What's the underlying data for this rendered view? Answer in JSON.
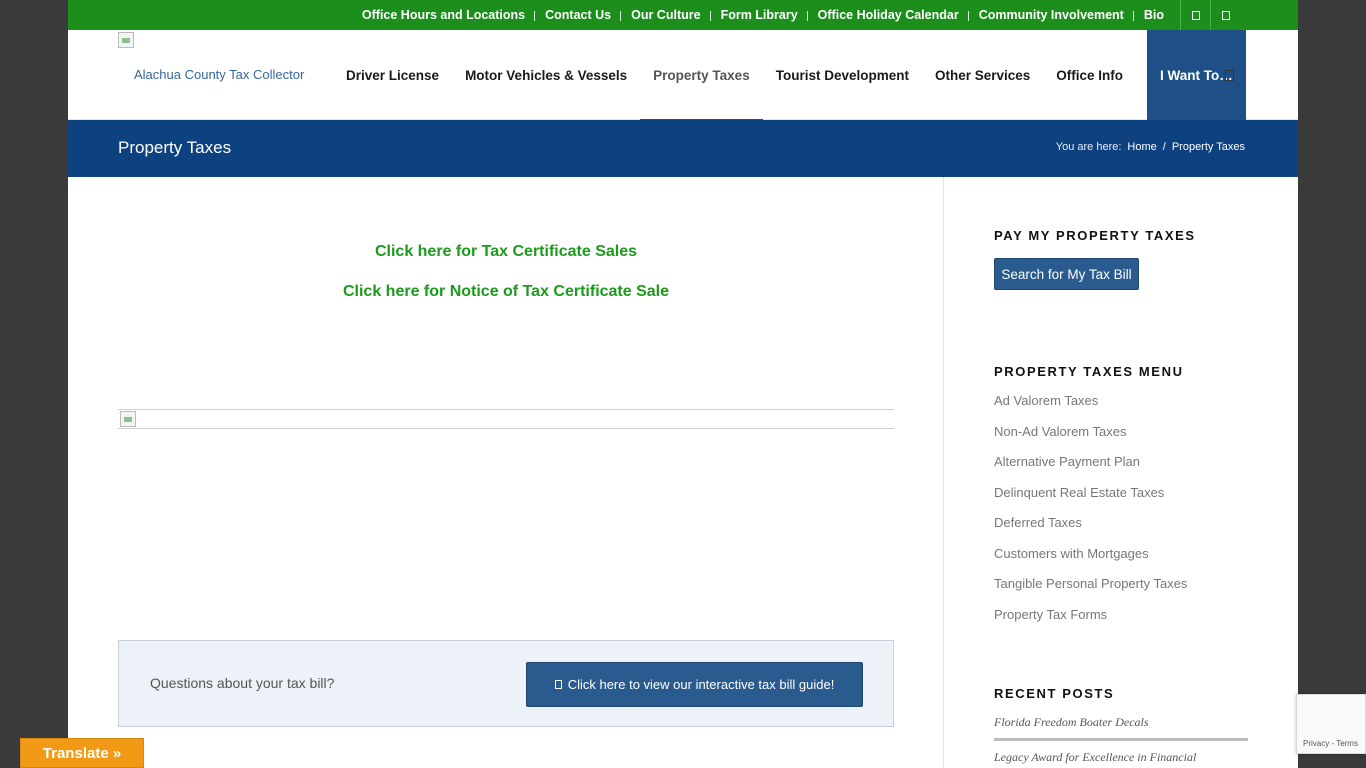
{
  "topbar": {
    "links": [
      "Office Hours and Locations",
      "Contact Us",
      "Our Culture",
      "Form Library",
      "Office Holiday Calendar",
      "Community Involvement",
      "Bio"
    ]
  },
  "header": {
    "logo_alt": "Alachua County Tax Collector",
    "nav": [
      "Driver License",
      "Motor Vehicles & Vessels",
      "Property Taxes",
      "Tourist Development",
      "Other Services",
      "Office Info"
    ],
    "active_nav": "Property Taxes",
    "cta": "I Want To…"
  },
  "titlebar": {
    "title": "Property Taxes",
    "breadcrumb_label": "You are here:",
    "breadcrumb_home": "Home",
    "breadcrumb_sep": "/",
    "breadcrumb_current": "Property Taxes"
  },
  "content": {
    "link1": "Click here for Tax Certificate Sales",
    "link2": "Click here for Notice of Tax Certificate Sale",
    "question": "Questions about your tax bill?",
    "guide_button": "Click here to view our interactive tax bill guide!"
  },
  "sidebar": {
    "pay_title": "PAY MY PROPERTY TAXES",
    "pay_button": "Search for My Tax Bill",
    "menu_title": "PROPERTY TAXES MENU",
    "menu": [
      "Ad Valorem Taxes",
      "Non-Ad Valorem Taxes",
      "Alternative Payment Plan",
      "Delinquent Real Estate Taxes",
      "Deferred Taxes",
      "Customers with Mortgages",
      "Tangible Personal Property Taxes",
      "Property Tax Forms"
    ],
    "posts_title": "RECENT POSTS",
    "posts": [
      "Florida Freedom Boater Decals",
      "Legacy Award for Excellence in Financial"
    ]
  },
  "overlays": {
    "translate": "Translate »",
    "recaptcha_legal": "Privacy - Terms"
  },
  "colors": {
    "topbar_green": "#1b8e1b",
    "brand_blue": "#0d4180",
    "link_green": "#1b9b1b",
    "button_blue": "#2a5b8e",
    "translate_orange": "#f29a16"
  }
}
